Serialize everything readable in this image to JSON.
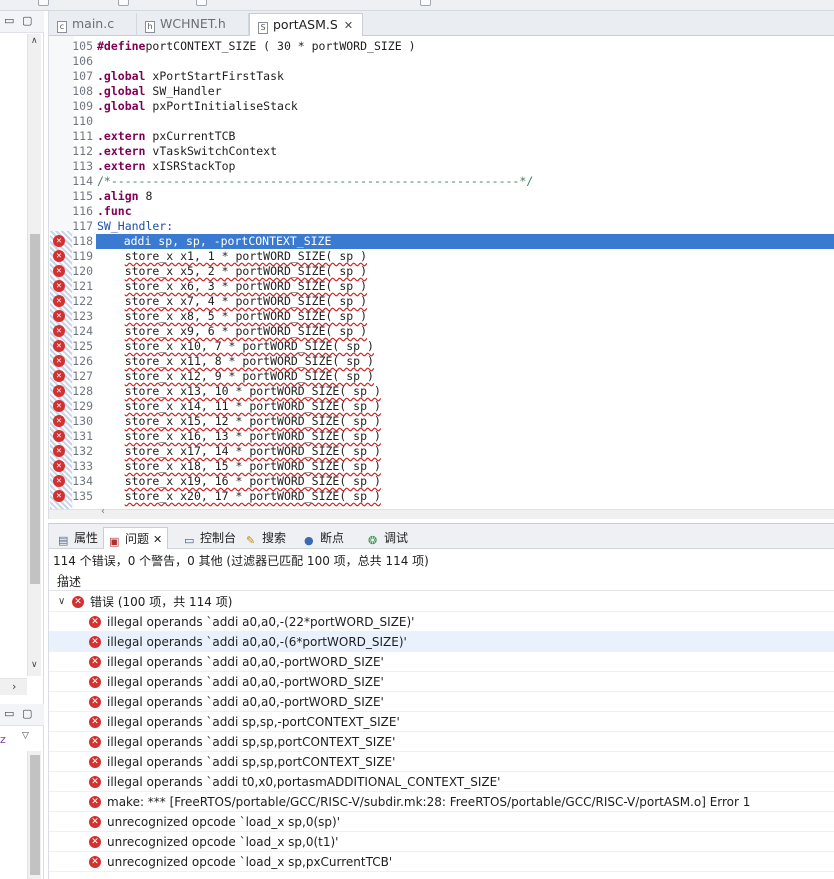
{
  "editor": {
    "tabs": [
      {
        "label": "main.c",
        "icon": "c-file-icon",
        "active": false
      },
      {
        "label": "WCHNET.h",
        "icon": "h-file-icon",
        "active": false
      },
      {
        "label": "portASM.S",
        "icon": "s-file-icon",
        "active": true,
        "close": "✕"
      }
    ],
    "lines": [
      {
        "num": "105",
        "parts": [
          [
            "kw",
            "#define"
          ],
          [
            "",
            "portCONTEXT_SIZE ( 30 * portWORD_SIZE )"
          ]
        ]
      },
      {
        "num": "106",
        "parts": []
      },
      {
        "num": "107",
        "parts": [
          [
            "kw",
            ".global"
          ],
          [
            "",
            " xPortStartFirstTask"
          ]
        ]
      },
      {
        "num": "108",
        "parts": [
          [
            "kw",
            ".global"
          ],
          [
            "",
            " SW_Handler"
          ]
        ]
      },
      {
        "num": "109",
        "parts": [
          [
            "kw",
            ".global"
          ],
          [
            "",
            " pxPortInitialiseStack"
          ]
        ]
      },
      {
        "num": "110",
        "parts": []
      },
      {
        "num": "111",
        "parts": [
          [
            "kw",
            ".extern"
          ],
          [
            "",
            " pxCurrentTCB"
          ]
        ]
      },
      {
        "num": "112",
        "parts": [
          [
            "kw",
            ".extern"
          ],
          [
            "",
            " vTaskSwitchContext"
          ]
        ]
      },
      {
        "num": "113",
        "parts": [
          [
            "kw",
            ".extern"
          ],
          [
            "",
            " xISRStackTop"
          ]
        ]
      },
      {
        "num": "114",
        "parts": [
          [
            "cm",
            "/*-----------------------------------------------------------*/"
          ]
        ]
      },
      {
        "num": "115",
        "parts": [
          [
            "kw",
            ".align"
          ],
          [
            "",
            " 8"
          ]
        ]
      },
      {
        "num": "116",
        "parts": [
          [
            "kw",
            ".func"
          ]
        ]
      },
      {
        "num": "117",
        "parts": [
          [
            "lbl",
            "SW_Handler:"
          ]
        ]
      },
      {
        "num": "118",
        "err": true,
        "sel": true,
        "parts": [
          [
            "",
            "    addi sp, sp, -portCONTEXT_SIZE"
          ]
        ]
      },
      {
        "num": "119",
        "err": true,
        "parts": [
          [
            "",
            "    "
          ],
          [
            "w",
            "store_x x1, 1 * portWORD_SIZE( sp )"
          ]
        ]
      },
      {
        "num": "120",
        "err": true,
        "parts": [
          [
            "",
            "    "
          ],
          [
            "w",
            "store_x x5, 2 * portWORD_SIZE( sp )"
          ]
        ]
      },
      {
        "num": "121",
        "err": true,
        "parts": [
          [
            "",
            "    "
          ],
          [
            "w",
            "store_x x6, 3 * portWORD_SIZE( sp )"
          ]
        ]
      },
      {
        "num": "122",
        "err": true,
        "parts": [
          [
            "",
            "    "
          ],
          [
            "w",
            "store_x x7, 4 * portWORD_SIZE( sp )"
          ]
        ]
      },
      {
        "num": "123",
        "err": true,
        "parts": [
          [
            "",
            "    "
          ],
          [
            "w",
            "store_x x8, 5 * portWORD_SIZE( sp )"
          ]
        ]
      },
      {
        "num": "124",
        "err": true,
        "parts": [
          [
            "",
            "    "
          ],
          [
            "w",
            "store_x x9, 6 * portWORD_SIZE( sp )"
          ]
        ]
      },
      {
        "num": "125",
        "err": true,
        "parts": [
          [
            "",
            "    "
          ],
          [
            "w",
            "store_x x10, 7 * portWORD_SIZE( sp )"
          ]
        ]
      },
      {
        "num": "126",
        "err": true,
        "parts": [
          [
            "",
            "    "
          ],
          [
            "w",
            "store_x x11, 8 * portWORD_SIZE( sp )"
          ]
        ]
      },
      {
        "num": "127",
        "err": true,
        "parts": [
          [
            "",
            "    "
          ],
          [
            "w",
            "store_x x12, 9 * portWORD_SIZE( sp )"
          ]
        ]
      },
      {
        "num": "128",
        "err": true,
        "parts": [
          [
            "",
            "    "
          ],
          [
            "w",
            "store_x x13, 10 * portWORD_SIZE( sp )"
          ]
        ]
      },
      {
        "num": "129",
        "err": true,
        "parts": [
          [
            "",
            "    "
          ],
          [
            "w",
            "store_x x14, 11 * portWORD_SIZE( sp )"
          ]
        ]
      },
      {
        "num": "130",
        "err": true,
        "parts": [
          [
            "",
            "    "
          ],
          [
            "w",
            "store_x x15, 12 * portWORD_SIZE( sp )"
          ]
        ]
      },
      {
        "num": "131",
        "err": true,
        "parts": [
          [
            "",
            "    "
          ],
          [
            "w",
            "store_x x16, 13 * portWORD_SIZE( sp )"
          ]
        ]
      },
      {
        "num": "132",
        "err": true,
        "parts": [
          [
            "",
            "    "
          ],
          [
            "w",
            "store_x x17, 14 * portWORD_SIZE( sp )"
          ]
        ]
      },
      {
        "num": "133",
        "err": true,
        "parts": [
          [
            "",
            "    "
          ],
          [
            "w",
            "store_x x18, 15 * portWORD_SIZE( sp )"
          ]
        ]
      },
      {
        "num": "134",
        "err": true,
        "parts": [
          [
            "",
            "    "
          ],
          [
            "w",
            "store_x x19, 16 * portWORD_SIZE( sp )"
          ]
        ]
      },
      {
        "num": "135",
        "err": true,
        "parts": [
          [
            "",
            "    "
          ],
          [
            "w",
            "store_x x20, 17 * portWORD_SIZE( sp )"
          ]
        ]
      }
    ]
  },
  "views": {
    "tabs": [
      {
        "label": "属性",
        "icon": "properties-icon",
        "active": false
      },
      {
        "label": "问题",
        "icon": "problems-icon",
        "active": true,
        "close": "✕"
      },
      {
        "label": "控制台",
        "icon": "console-icon",
        "active": false
      },
      {
        "label": "搜索",
        "icon": "search-icon",
        "active": false
      },
      {
        "label": "断点",
        "icon": "breakpoints-icon",
        "active": false
      },
      {
        "label": "调试",
        "icon": "debug-icon",
        "active": false
      }
    ]
  },
  "problems": {
    "summary": "114 个错误，0 个警告，0 其他 (过滤器已匹配 100 项，总共 114 项)",
    "column_header": "描述",
    "group_label": "错误 (100 项，共 114 项)",
    "items": [
      "illegal operands `addi a0,a0,-(22*portWORD_SIZE)'",
      "illegal operands `addi a0,a0,-(6*portWORD_SIZE)'",
      "illegal operands `addi a0,a0,-portWORD_SIZE'",
      "illegal operands `addi a0,a0,-portWORD_SIZE'",
      "illegal operands `addi a0,a0,-portWORD_SIZE'",
      "illegal operands `addi sp,sp,-portCONTEXT_SIZE'",
      "illegal operands `addi sp,sp,portCONTEXT_SIZE'",
      "illegal operands `addi sp,sp,portCONTEXT_SIZE'",
      "illegal operands `addi t0,x0,portasmADDITIONAL_CONTEXT_SIZE'",
      "make: *** [FreeRTOS/portable/GCC/RISC-V/subdir.mk:28: FreeRTOS/portable/GCC/RISC-V/portASM.o] Error 1",
      "unrecognized opcode `load_x sp,0(sp)'",
      "unrecognized opcode `load_x sp,0(t1)'",
      "unrecognized opcode `load_x sp,pxCurrentTCB'"
    ],
    "highlighted_index": 1
  },
  "colors": {
    "selection": "#3b7ad1",
    "error": "#d33030",
    "keyword": "#7f0055",
    "comment": "#3f7f5f",
    "row_highlight": "#e9f2fc"
  }
}
